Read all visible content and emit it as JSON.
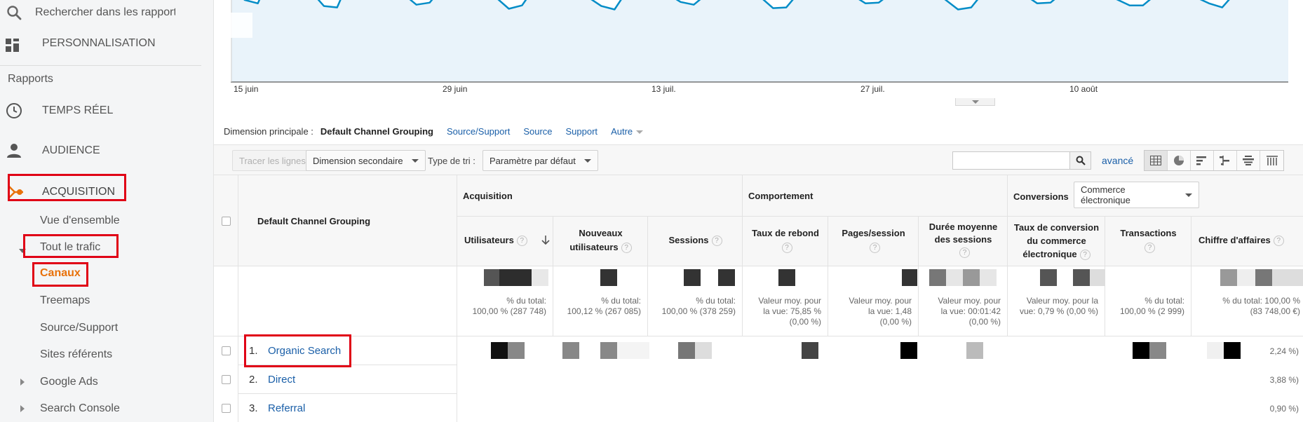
{
  "sidebar": {
    "search_placeholder": "Rechercher dans les rapports",
    "customization": "PERSONNALISATION",
    "reports_heading": "Rapports",
    "realtime": "TEMPS RÉEL",
    "audience": "AUDIENCE",
    "acquisition": "ACQUISITION",
    "overview": "Vue d'ensemble",
    "all_traffic": "Tout le trafic",
    "channels": "Canaux",
    "treemaps": "Treemaps",
    "source_medium": "Source/Support",
    "referrals": "Sites référents",
    "google_ads": "Google Ads",
    "search_console": "Search Console"
  },
  "colors": {
    "accent_orange": "#e8710a",
    "link_blue": "#1a5fa8",
    "chart_line": "#058dc7",
    "highlight_red": "#e00016"
  },
  "chart": {
    "xticks": [
      "15 juin",
      "29 juin",
      "13 juil.",
      "27 juil.",
      "10 août"
    ]
  },
  "chart_data": {
    "type": "area",
    "series": [
      {
        "values": [
          100,
          75,
          70,
          115,
          105,
          98,
          88,
          66,
          64,
          108,
          104,
          98,
          94,
          84,
          68,
          71,
          94,
          101,
          100,
          90,
          79,
          62,
          67,
          95,
          88,
          87,
          86,
          79,
          66,
          61,
          90,
          89,
          87,
          84,
          72,
          68,
          84,
          90,
          87,
          86,
          80,
          63,
          64,
          87,
          88,
          86,
          83,
          82,
          70,
          71,
          86,
          87,
          88,
          87,
          76,
          61,
          64,
          88,
          89,
          90,
          83,
          70,
          71,
          87,
          87,
          84,
          83,
          76,
          67,
          67,
          83,
          86,
          83,
          79,
          70,
          64,
          86,
          85,
          87,
          88,
          86
        ]
      }
    ]
  },
  "dimension_bar": {
    "label": "Dimension principale :",
    "current": "Default Channel Grouping",
    "links": [
      "Source/Support",
      "Source",
      "Support",
      "Autre"
    ]
  },
  "toolbar": {
    "plot_rows": "Tracer les lignes",
    "secondary_dimension": "Dimension secondaire",
    "sort_label": "Type de tri :",
    "sort_value": "Paramètre par défaut",
    "advanced": "avancé"
  },
  "table": {
    "dim_header": "Default Channel Grouping",
    "groups": {
      "acquisition": "Acquisition",
      "behavior": "Comportement",
      "conversions": "Conversions",
      "conversions_select": "Commerce électronique"
    },
    "columns": {
      "users": "Utilisateurs",
      "new_users_1": "Nouveaux",
      "new_users_2": "utilisateurs",
      "sessions": "Sessions",
      "bounce_1": "Taux de rebond",
      "pages": "Pages/session",
      "duration_1": "Durée moyenne",
      "duration_2": "des sessions",
      "conv_1": "Taux de conversion",
      "conv_2": "du commerce",
      "conv_3": "électronique",
      "transactions": "Transactions",
      "revenue": "Chiffre d'affaires"
    },
    "totals": {
      "users_1": "% du total:",
      "users_2": "100,00 % (287 748)",
      "new_1": "% du total:",
      "new_2": "100,12 % (267 085)",
      "sessions_1": "% du total:",
      "sessions_2": "100,00 % (378 259)",
      "bounce_1": "Valeur moy. pour",
      "bounce_2": "la vue: 75,85 %",
      "bounce_3": "(0,00 %)",
      "pages_1": "Valeur moy. pour",
      "pages_2": "la vue: 1,48",
      "pages_3": "(0,00 %)",
      "duration_1": "Valeur moy. pour",
      "duration_2": "la vue: 00:01:42",
      "duration_3": "(0,00 %)",
      "conv_1": "Valeur moy. pour la",
      "conv_2": "vue: 0,79 % (0,00 %)",
      "trans_1": "% du total:",
      "trans_2": "100,00 % (2 999)",
      "rev_1": "% du total: 100,00 %",
      "rev_2": "(83 748,00 €)"
    },
    "rows": [
      {
        "num": "1.",
        "label": "Organic Search",
        "pct": "2,24 %)"
      },
      {
        "num": "2.",
        "label": "Direct",
        "pct": "3,88 %)"
      },
      {
        "num": "3.",
        "label": "Referral",
        "pct": "0,90 %)"
      }
    ]
  }
}
